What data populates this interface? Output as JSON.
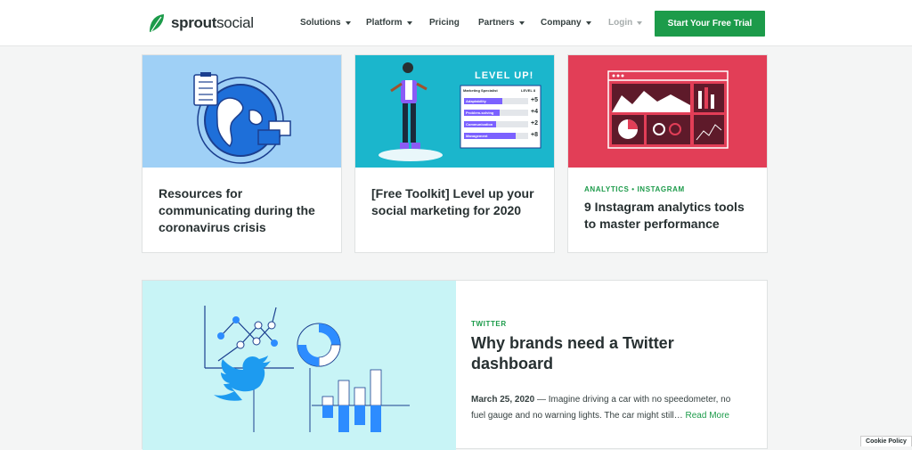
{
  "brand": {
    "name_bold": "sprout",
    "name_light": "social",
    "accent": "#1c9b4a"
  },
  "nav": {
    "items": [
      {
        "label": "Solutions",
        "dropdown": true
      },
      {
        "label": "Platform",
        "dropdown": true
      },
      {
        "label": "Pricing",
        "dropdown": false
      },
      {
        "label": "Partners",
        "dropdown": true
      },
      {
        "label": "Company",
        "dropdown": true
      },
      {
        "label": "Login",
        "dropdown": true
      }
    ],
    "cta_label": "Start Your Free Trial"
  },
  "cards": [
    {
      "title": "Resources for communicating during the coronavirus crisis",
      "eyebrow": "",
      "image_bg": "#9fd0f6"
    },
    {
      "title": "[Free Toolkit] Level up your social marketing for 2020",
      "eyebrow": "",
      "image_bg": "#1bb6cc",
      "illustration": {
        "heading": "LEVEL UP!",
        "header_left": "Marketing Specialist",
        "header_right": "LEVEL 8",
        "skills": [
          {
            "name": "Adaptability",
            "value": "+5",
            "level": 0.6
          },
          {
            "name": "Problem-solving",
            "value": "+4",
            "level": 0.55
          },
          {
            "name": "Communication",
            "value": "+2",
            "level": 0.5
          },
          {
            "name": "Management",
            "value": "+8",
            "level": 0.8
          }
        ]
      }
    },
    {
      "title": "9 Instagram analytics tools to master performance",
      "eyebrow": "ANALYTICS • INSTAGRAM",
      "image_bg": "#e23e57"
    }
  ],
  "feature": {
    "eyebrow": "TWITTER",
    "title": "Why brands need a Twitter dashboard",
    "date": "March 25, 2020",
    "excerpt": " — Imagine driving a car with no speedometer, no fuel gauge and no warning lights. The car might still…",
    "read_more": "Read More"
  },
  "cookie_label": "Cookie Policy"
}
